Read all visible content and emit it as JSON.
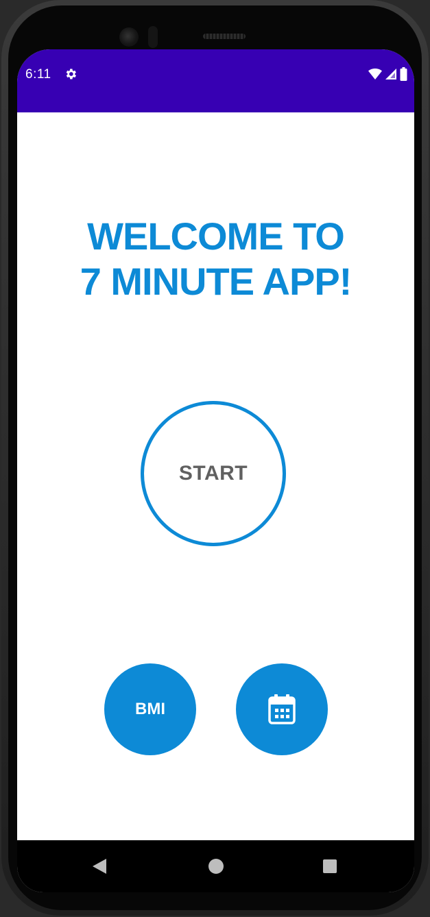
{
  "status_bar": {
    "time": "6:11",
    "settings_icon": "gear-icon",
    "wifi_icon": "wifi-icon",
    "signal_icon": "cell-signal-icon",
    "battery_icon": "battery-icon"
  },
  "main": {
    "title_line1": "WELCOME TO",
    "title_line2": "7 MINUTE APP!",
    "start_label": "START",
    "bmi_label": "BMI",
    "history_icon": "calendar-icon"
  },
  "nav_bar": {
    "back_icon": "back-triangle-icon",
    "home_icon": "home-circle-icon",
    "recents_icon": "recents-square-icon"
  },
  "colors": {
    "status_bar": "#3700b3",
    "accent": "#0d8ad6",
    "start_text": "#606060",
    "background": "#ffffff"
  }
}
